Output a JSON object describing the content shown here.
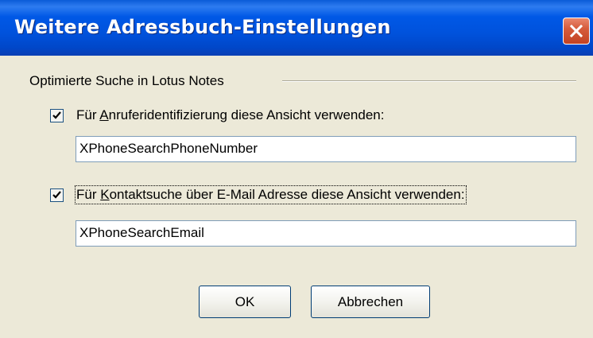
{
  "window": {
    "title": "Weitere Adressbuch-Einstellungen"
  },
  "group": {
    "label": "Optimierte Suche in Lotus Notes"
  },
  "option1": {
    "checked": true,
    "label_prefix": "Für ",
    "label_mnemonic": "A",
    "label_suffix": "nruferidentifizierung diese Ansicht verwenden:",
    "value": "XPhoneSearchPhoneNumber"
  },
  "option2": {
    "checked": true,
    "label_prefix": "Für ",
    "label_mnemonic": "K",
    "label_suffix": "ontaktsuche über E-Mail Adresse diese Ansicht verwenden:",
    "value": "XPhoneSearchEmail"
  },
  "buttons": {
    "ok": "OK",
    "cancel": "Abbrechen"
  },
  "colors": {
    "titlebar": "#0058e6",
    "face": "#ece9d8",
    "close": "#d65c3c"
  },
  "icons": {
    "close": "close-icon",
    "check": "checkmark-icon"
  }
}
